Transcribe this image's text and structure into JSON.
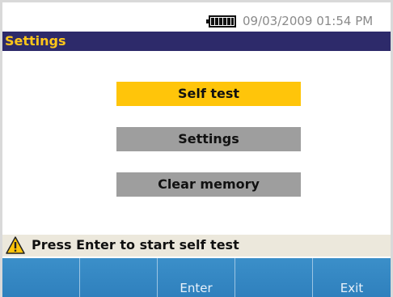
{
  "status": {
    "datetime": "09/03/2009 01:54 PM",
    "battery_icon": "battery-full-icon"
  },
  "title": "Settings",
  "menu": [
    {
      "label": "Self test",
      "selected": true
    },
    {
      "label": "Settings",
      "selected": false
    },
    {
      "label": "Clear memory",
      "selected": false
    }
  ],
  "message": {
    "icon": "warning-icon",
    "text": "Press Enter to start self test"
  },
  "softkeys": [
    "",
    "",
    "Enter",
    "",
    "Exit"
  ],
  "colors": {
    "title_bg": "#2d2a6a",
    "title_text": "#ffc61a",
    "selected_bg": "#ffc50a",
    "button_bg": "#9e9e9e",
    "softkey_bg": "#2f80bd",
    "message_bg": "#ece8dc"
  }
}
